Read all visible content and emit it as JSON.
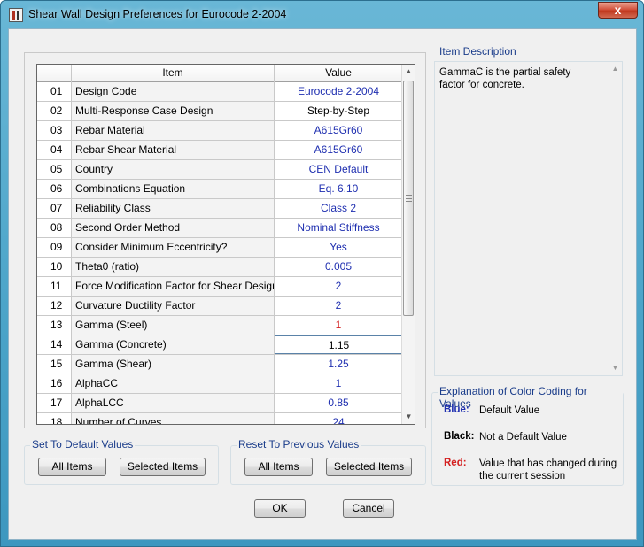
{
  "window": {
    "title": "Shear Wall Design Preferences for Eurocode 2-2004",
    "close_glyph": "x"
  },
  "grid": {
    "columns": {
      "item": "Item",
      "value": "Value"
    },
    "rows": [
      {
        "num": "01",
        "item": "Design Code",
        "value": "Eurocode 2-2004",
        "color": "#1f2fb0"
      },
      {
        "num": "02",
        "item": "Multi-Response Case Design",
        "value": "Step-by-Step",
        "color": "#000000"
      },
      {
        "num": "03",
        "item": "Rebar Material",
        "value": "A615Gr60",
        "color": "#1f2fb0"
      },
      {
        "num": "04",
        "item": "Rebar Shear Material",
        "value": "A615Gr60",
        "color": "#1f2fb0"
      },
      {
        "num": "05",
        "item": "Country",
        "value": "CEN Default",
        "color": "#1f2fb0"
      },
      {
        "num": "06",
        "item": "Combinations Equation",
        "value": "Eq. 6.10",
        "color": "#1f2fb0"
      },
      {
        "num": "07",
        "item": "Reliability Class",
        "value": "Class 2",
        "color": "#1f2fb0"
      },
      {
        "num": "08",
        "item": "Second Order Method",
        "value": "Nominal Stiffness",
        "color": "#1f2fb0"
      },
      {
        "num": "09",
        "item": "Consider Minimum Eccentricity?",
        "value": "Yes",
        "color": "#1f2fb0"
      },
      {
        "num": "10",
        "item": "Theta0 (ratio)",
        "value": "0.005",
        "color": "#1f2fb0"
      },
      {
        "num": "11",
        "item": "Force Modification Factor for Shear Design",
        "value": "2",
        "color": "#1f2fb0"
      },
      {
        "num": "12",
        "item": "Curvature Ductility Factor",
        "value": "2",
        "color": "#1f2fb0"
      },
      {
        "num": "13",
        "item": "Gamma (Steel)",
        "value": "1",
        "color": "#d42020"
      },
      {
        "num": "14",
        "item": "Gamma (Concrete)",
        "value": "1.15",
        "color": "#000000",
        "selected": true
      },
      {
        "num": "15",
        "item": "Gamma (Shear)",
        "value": "1.25",
        "color": "#1f2fb0"
      },
      {
        "num": "16",
        "item": "AlphaCC",
        "value": "1",
        "color": "#1f2fb0"
      },
      {
        "num": "17",
        "item": "AlphaLCC",
        "value": "0.85",
        "color": "#1f2fb0"
      },
      {
        "num": "18",
        "item": "Number of Curves",
        "value": "24",
        "color": "#1f2fb0"
      }
    ]
  },
  "item_description": {
    "label": "Item Description",
    "text": "GammaC is the partial safety factor for concrete."
  },
  "color_legend": {
    "label": "Explanation of Color Coding for Values",
    "blue": {
      "key": "Blue:",
      "text": "Default Value",
      "color": "#1f2fb0"
    },
    "black": {
      "key": "Black:",
      "text": "Not a Default Value",
      "color": "#000000"
    },
    "red": {
      "key": "Red:",
      "text": "Value that has changed during the current session",
      "color": "#d42020"
    }
  },
  "set_default": {
    "label": "Set To Default Values",
    "all_items": "All Items",
    "selected_items": "Selected Items"
  },
  "reset_previous": {
    "label": "Reset To Previous Values",
    "all_items": "All Items",
    "selected_items": "Selected Items"
  },
  "footer": {
    "ok": "OK",
    "cancel": "Cancel"
  },
  "colors": {
    "group_label": "#1a3c8a",
    "title_bar": "#4aa3c8"
  }
}
